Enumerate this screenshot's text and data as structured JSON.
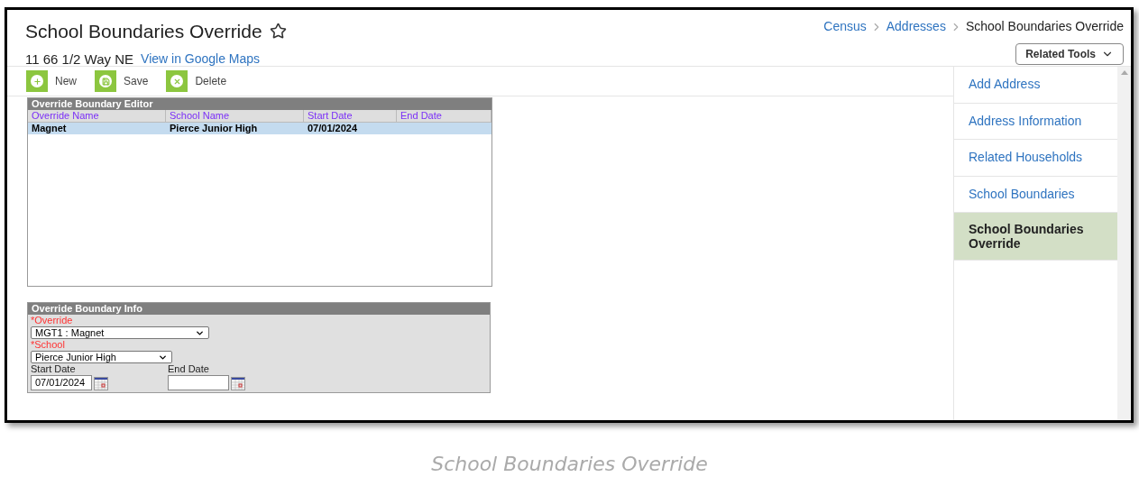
{
  "header": {
    "title": "School Boundaries Override",
    "address": "11 66 1/2 Way NE",
    "map_link": "View in Google Maps",
    "breadcrumbs": [
      {
        "label": "Census",
        "kind": "link"
      },
      {
        "label": "Addresses",
        "kind": "link"
      },
      {
        "label": "School Boundaries Override",
        "kind": "current"
      }
    ],
    "related_tools": "Related Tools"
  },
  "toolbar": [
    {
      "label": "New",
      "kind": "new"
    },
    {
      "label": "Save",
      "kind": "save"
    },
    {
      "label": "Delete",
      "kind": "delete"
    }
  ],
  "editor": {
    "title": "Override Boundary Editor",
    "columns": [
      "Override Name",
      "School Name",
      "Start Date",
      "End Date"
    ],
    "rows": [
      {
        "cells": [
          "Magnet",
          "Pierce Junior High",
          "07/01/2024"
        ],
        "selected": true
      }
    ]
  },
  "info": {
    "title": "Override Boundary Info",
    "fields": [
      {
        "label": "*Override",
        "kind": "select",
        "value": "MGT1 : Magnet",
        "required": true
      },
      {
        "label": "*School",
        "kind": "select",
        "value": "Pierce Junior High",
        "required": true
      },
      {
        "label": "Start Date",
        "kind": "date",
        "value": "07/01/2024",
        "required": false
      },
      {
        "label": "End Date",
        "kind": "date",
        "required": false
      }
    ]
  },
  "sidebar": {
    "items": [
      {
        "label": "Add Address",
        "selected": false
      },
      {
        "label": "Address Information",
        "selected": false
      },
      {
        "label": "Related Households",
        "selected": false
      },
      {
        "label": "School Boundaries",
        "selected": false
      },
      {
        "label": "School Boundaries Override",
        "selected": true
      }
    ]
  },
  "caption": "School Boundaries Override"
}
